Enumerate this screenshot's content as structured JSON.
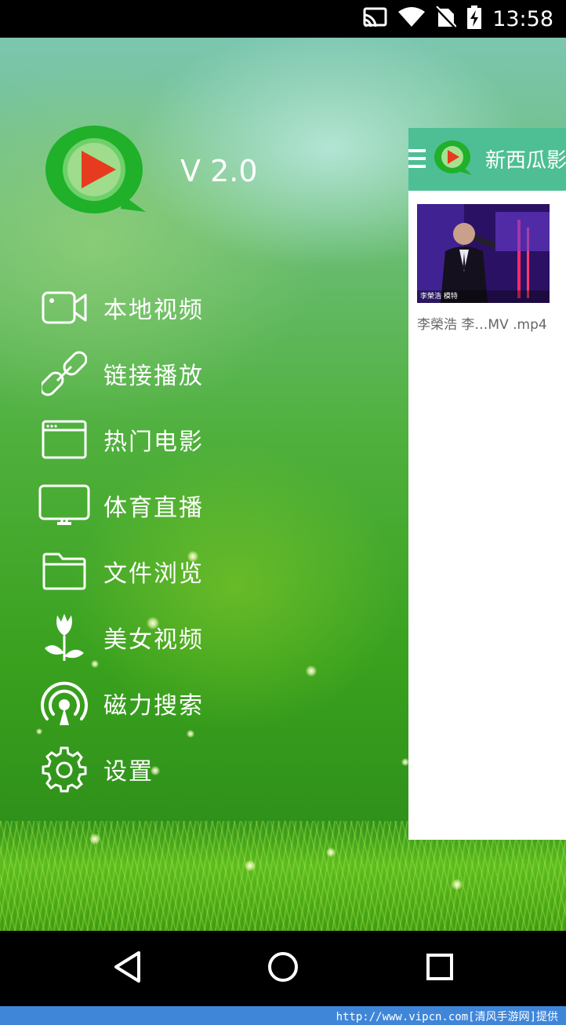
{
  "status_bar": {
    "time": "13:58",
    "icons": [
      "cast-icon",
      "wifi-icon",
      "no-sim-icon",
      "battery-charging-icon"
    ]
  },
  "drawer": {
    "version": "V 2.0",
    "menu_items": [
      {
        "label": "本地视频",
        "icon": "video-camera-icon"
      },
      {
        "label": "链接播放",
        "icon": "link-icon"
      },
      {
        "label": "热门电影",
        "icon": "browser-window-icon"
      },
      {
        "label": "体育直播",
        "icon": "monitor-icon"
      },
      {
        "label": "文件浏览",
        "icon": "folder-icon"
      },
      {
        "label": "美女视频",
        "icon": "flower-icon"
      },
      {
        "label": "磁力搜索",
        "icon": "magnet-signal-icon"
      },
      {
        "label": "设置",
        "icon": "gear-icon"
      }
    ]
  },
  "main_panel": {
    "title": "新西瓜影",
    "video_caption": "李榮浩 李…MV .mp4",
    "thumb_overlay_text": "李榮浩 模特",
    "accent_color": "#4ebf95"
  },
  "nav_bar": {
    "buttons": [
      "back-icon",
      "home-icon",
      "recents-icon"
    ]
  },
  "footer": {
    "text": "http://www.vipcn.com[清风手游网]提供"
  }
}
